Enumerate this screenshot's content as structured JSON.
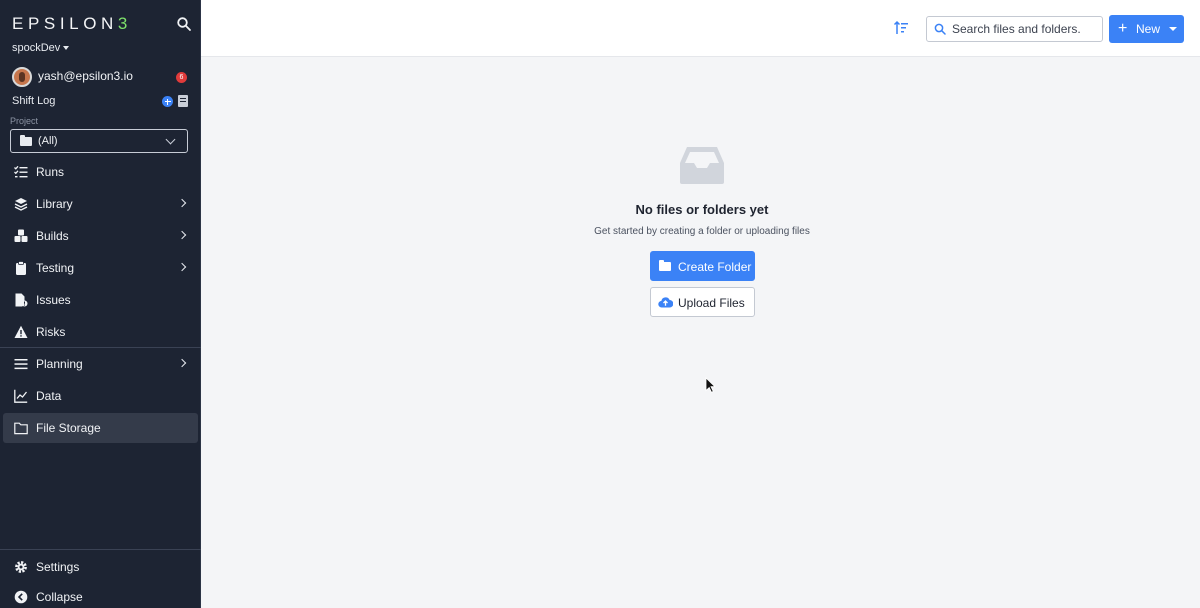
{
  "app": {
    "logo_main": "EPSILON",
    "logo_accent": "3",
    "workspace": "spockDev",
    "user_email": "yash@epsilon3.io",
    "notification_count": "6",
    "shift_log": "Shift Log",
    "project_label": "Project",
    "project_value": "(All)"
  },
  "nav": {
    "runs": "Runs",
    "library": "Library",
    "builds": "Builds",
    "testing": "Testing",
    "issues": "Issues",
    "risks": "Risks",
    "planning": "Planning",
    "data": "Data",
    "file_storage": "File Storage",
    "settings": "Settings",
    "collapse": "Collapse"
  },
  "toolbar": {
    "search_placeholder": "Search files and folders.",
    "new_label": "New"
  },
  "empty_state": {
    "title": "No files or folders yet",
    "subtitle": "Get started by creating a folder or uploading files",
    "create_folder": "Create Folder",
    "upload_files": "Upload Files"
  },
  "colors": {
    "sidebar_bg": "#1d2433",
    "accent": "#3b82f6",
    "logo_accent": "#7ee06a",
    "notification": "#e03b3b"
  }
}
